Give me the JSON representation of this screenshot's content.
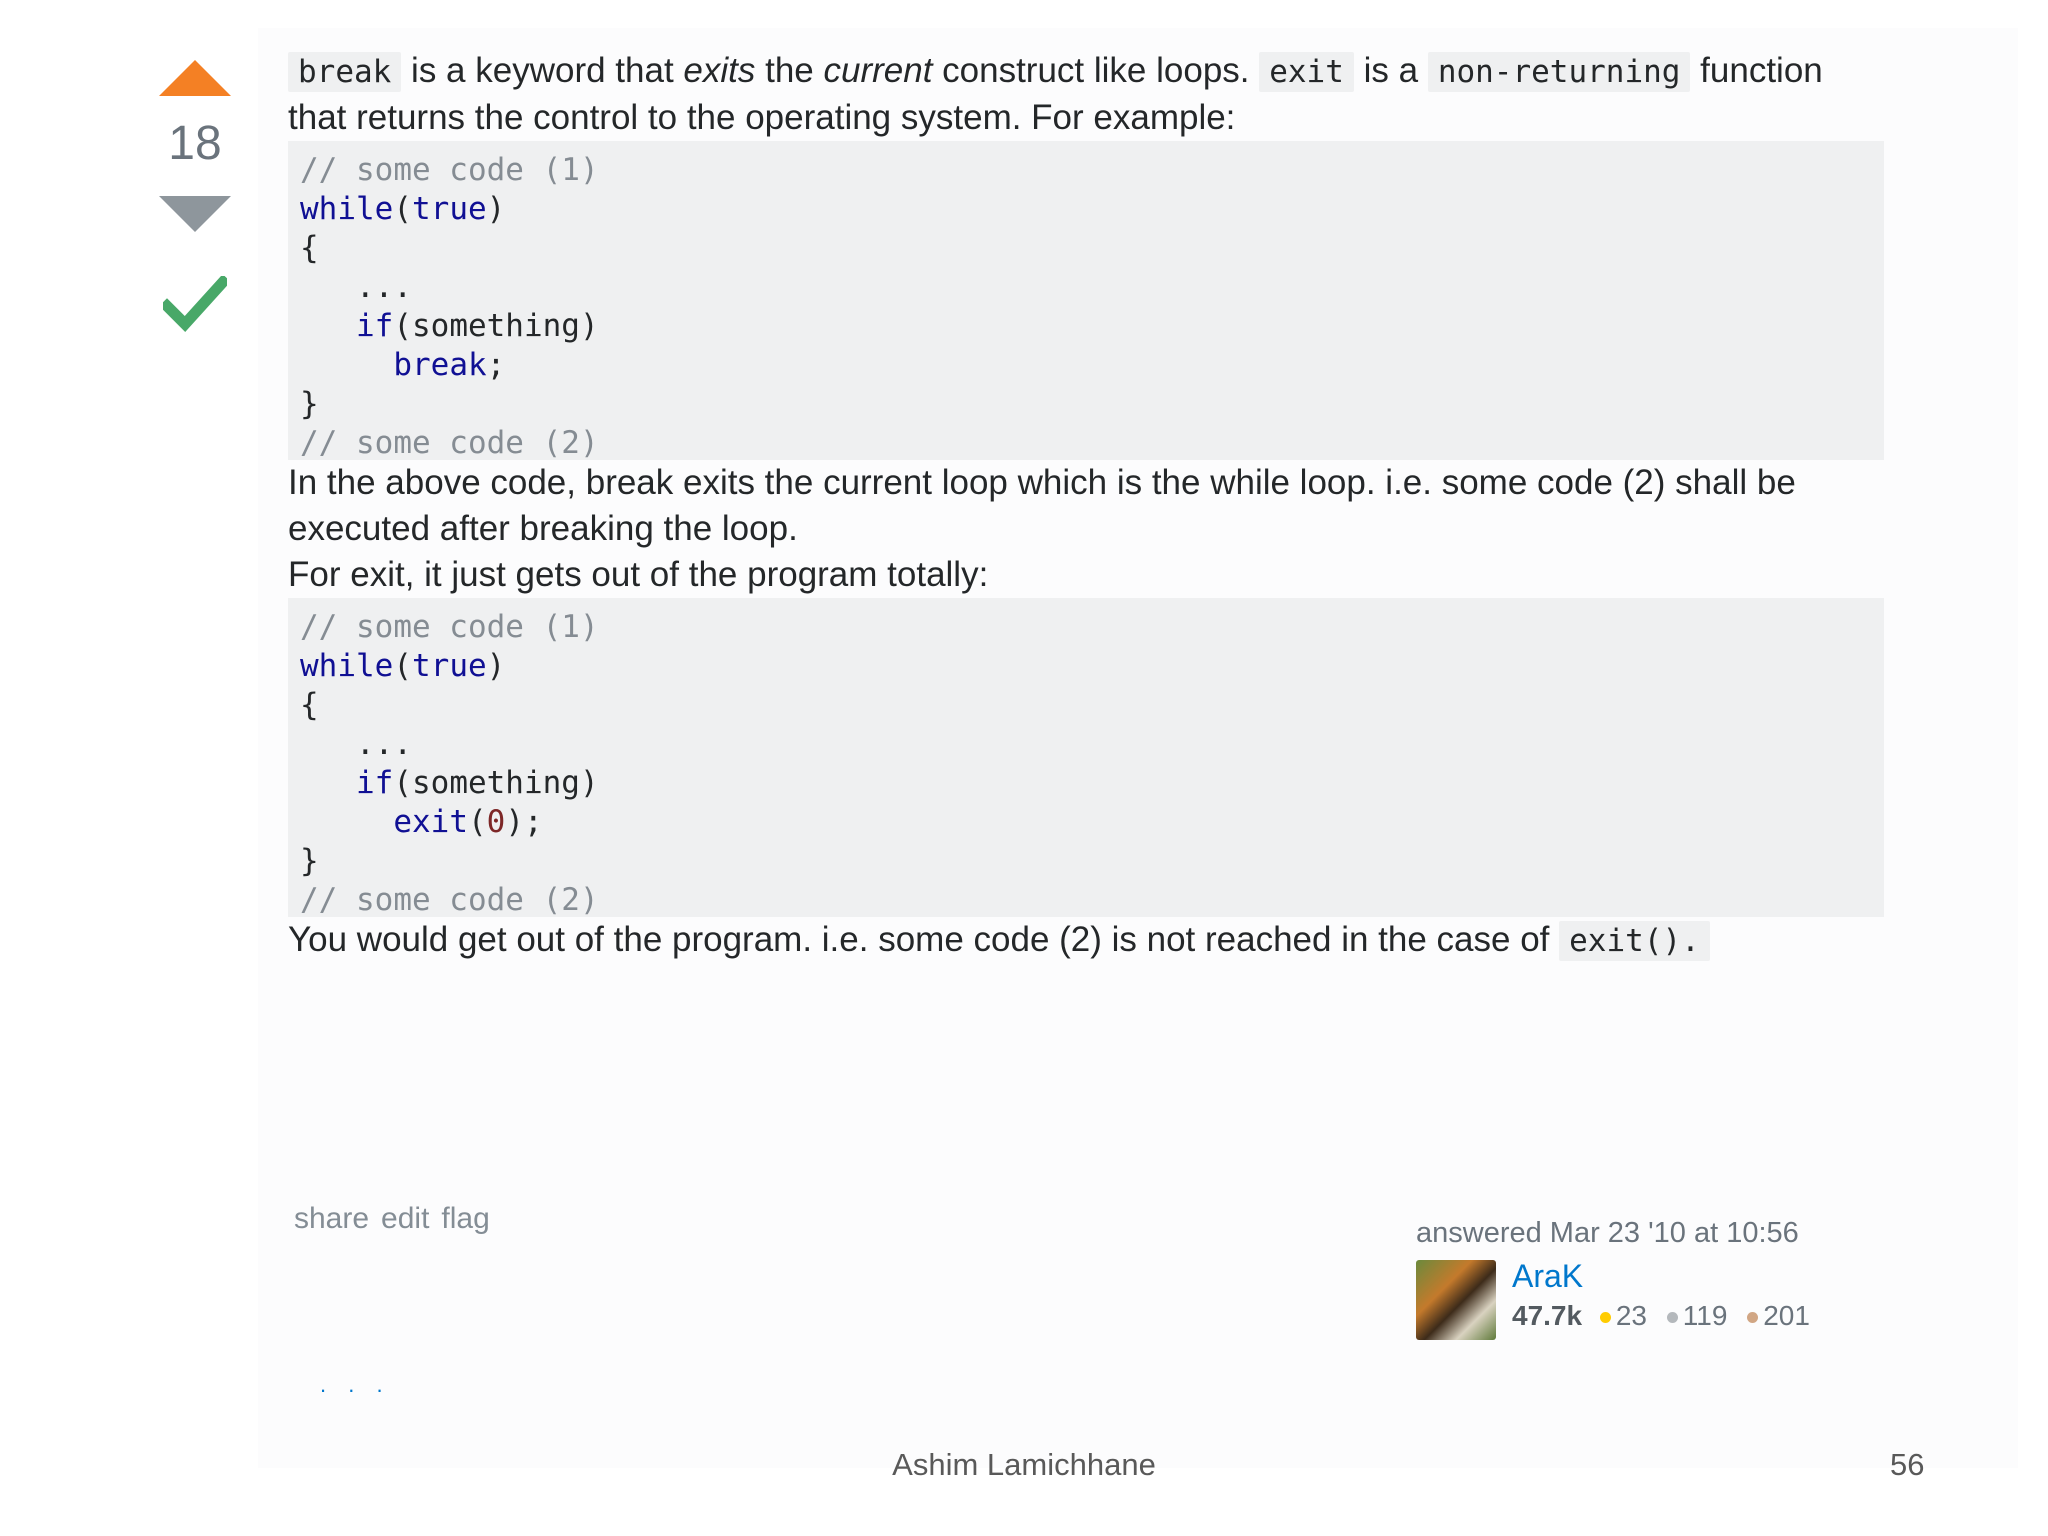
{
  "vote": {
    "count": "18"
  },
  "post": {
    "p1": {
      "code_break": "break",
      "t1": " is a keyword that ",
      "em1": "exits",
      "t2": " the ",
      "em2": "current",
      "t3": " construct like loops. ",
      "code_exit": "exit",
      "t4": " is a ",
      "code_nonret": "non-returning",
      "t5": " function that returns the control to the operating system. For example:"
    },
    "code1": {
      "l1": "// some code (1)",
      "l2_kw": "while",
      "l2_p": "(",
      "l2_true": "true",
      "l2_e": ")",
      "l3": "{",
      "l4": "   ...",
      "l5_ind": "   ",
      "l5_kw": "if",
      "l5_r": "(something)",
      "l6_ind": "     ",
      "l6_kw": "break",
      "l6_r": ";",
      "l7": "}",
      "l8": "// some code (2)"
    },
    "p2": "In the above code, break exits the current loop which is the while loop. i.e. some code (2) shall be executed after breaking the loop.",
    "p3": "For exit, it just gets out of the program totally:",
    "code2": {
      "l1": "// some code (1)",
      "l2_kw": "while",
      "l2_p": "(",
      "l2_true": "true",
      "l2_e": ")",
      "l3": "{",
      "l4": "   ...",
      "l5_ind": "   ",
      "l5_kw": "if",
      "l5_r": "(something)",
      "l6_ind": "     ",
      "l6_kw": "exit",
      "l6_p": "(",
      "l6_num": "0",
      "l6_r": ");",
      "l7": "}",
      "l8": "// some code (2)"
    },
    "p4": {
      "text": "You would get out of the program. i.e. some code (2) is not reached in the case of ",
      "code": "exit()."
    }
  },
  "menu": {
    "share": "share",
    "edit": "edit",
    "flag": "flag"
  },
  "signature": {
    "answered": "answered Mar 23 '10 at 10:56",
    "user": "AraK",
    "rep": "47.7k",
    "gold": "23",
    "silver": "119",
    "bronze": "201"
  },
  "cut_text": ". .          .",
  "footer": {
    "author": "Ashim Lamichhane",
    "page": "56"
  },
  "colors": {
    "upvote": "#f48024",
    "accepted": "#48a868",
    "link": "#0077cc",
    "code_bg": "#eff0f1"
  },
  "icons": {
    "upvote": "upvote-arrow-icon",
    "downvote": "downvote-arrow-icon",
    "accepted": "checkmark-icon"
  }
}
